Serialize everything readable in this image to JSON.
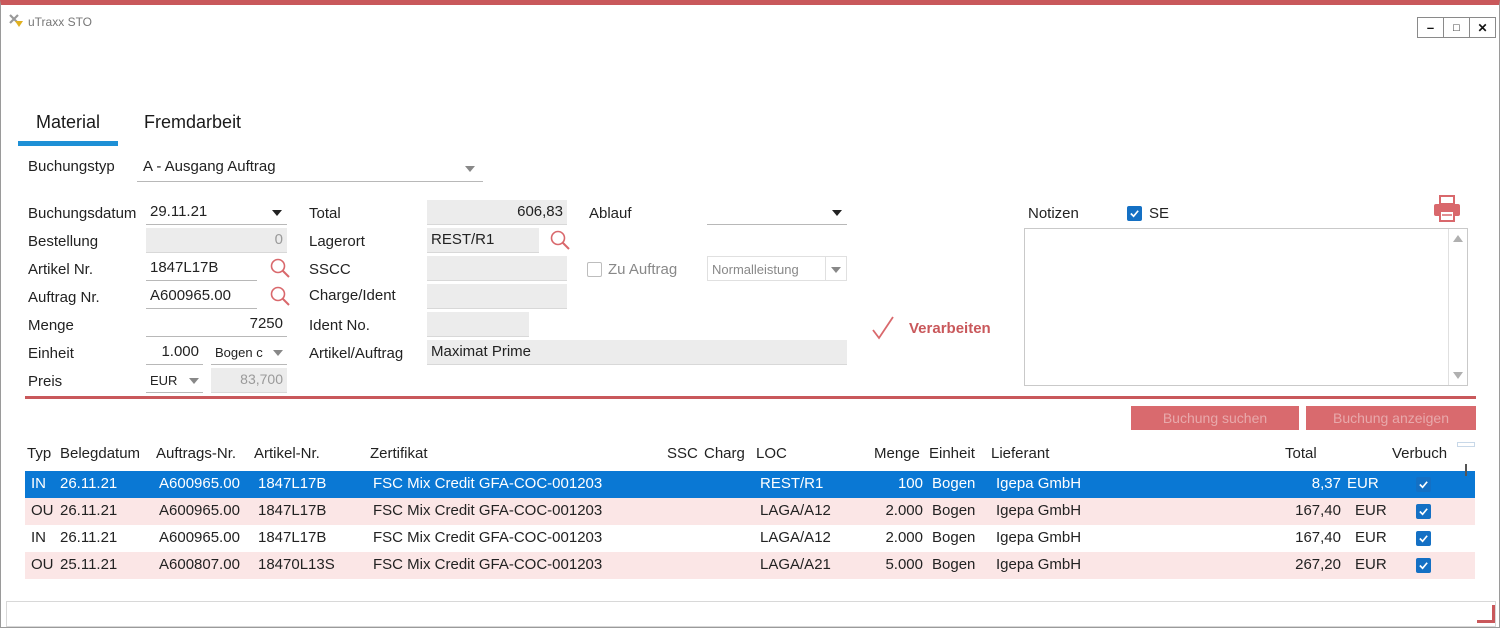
{
  "app": {
    "title": "uTraxx STO"
  },
  "window_controls": {
    "minimize": "–",
    "maximize": "□",
    "close": "✕"
  },
  "tabs": [
    {
      "label": "Material",
      "active": true
    },
    {
      "label": "Fremdarbeit",
      "active": false
    }
  ],
  "form": {
    "buchungstyp_label": "Buchungstyp",
    "buchungstyp_value": "A - Ausgang Auftrag",
    "buchungsdatum_label": "Buchungsdatum",
    "buchungsdatum_value": "29.11.21",
    "bestellung_label": "Bestellung",
    "bestellung_value": "0",
    "artikel_label": "Artikel Nr.",
    "artikel_value": "1847L17B",
    "auftrag_label": "Auftrag Nr.",
    "auftrag_value": "A600965.00",
    "menge_label": "Menge",
    "menge_value": "7250",
    "einheit_label": "Einheit",
    "einheit_qty": "1.000",
    "einheit_unit": "Bogen c",
    "preis_label": "Preis",
    "preis_currency": "EUR",
    "preis_value": "83,700",
    "total_label": "Total",
    "total_value": "606,83",
    "lagerort_label": "Lagerort",
    "lagerort_value": "REST/R1",
    "sscc_label": "SSCC",
    "sscc_value": "",
    "charge_label": "Charge/Ident",
    "charge_value": "",
    "identno_label": "Ident No.",
    "identno_value": "",
    "artikel_auftrag_label": "Artikel/Auftrag",
    "artikel_auftrag_value": "Maximat Prime",
    "ablauf_label": "Ablauf",
    "ablauf_value": "",
    "zu_auftrag_label": "Zu Auftrag",
    "zu_auftrag_checked": false,
    "leistung_value": "Normalleistung",
    "verarbeiten_label": "Verarbeiten"
  },
  "notes": {
    "label": "Notizen",
    "se_label": "SE",
    "se_checked": true,
    "text": ""
  },
  "actions": {
    "buchung_suchen": "Buchung suchen",
    "buchung_anzeigen": "Buchung anzeigen"
  },
  "table": {
    "headers": {
      "typ": "Typ",
      "belegdatum": "Belegdatum",
      "auftrags_nr": "Auftrags-Nr.",
      "artikel_nr": "Artikel-Nr.",
      "zertifikat": "Zertifikat",
      "ssc": "SSC",
      "charg": "Charg",
      "loc": "LOC",
      "menge": "Menge",
      "einheit": "Einheit",
      "lieferant": "Lieferant",
      "total": "Total",
      "verbuch": "Verbuch"
    },
    "rows": [
      {
        "typ": "IN",
        "belegdatum": "26.11.21",
        "auftrags_nr": "A600965.00",
        "artikel_nr": "1847L17B",
        "zertifikat": "FSC Mix Credit GFA-COC-001203",
        "loc": "REST/R1",
        "menge": "100",
        "einheit": "Bogen",
        "lieferant": "Igepa GmbH",
        "total": "8,37",
        "currency": "EUR",
        "verbuch": true
      },
      {
        "typ": "OU",
        "belegdatum": "26.11.21",
        "auftrags_nr": "A600965.00",
        "artikel_nr": "1847L17B",
        "zertifikat": "FSC Mix Credit GFA-COC-001203",
        "loc": "LAGA/A12",
        "menge": "2.000",
        "einheit": "Bogen",
        "lieferant": "Igepa GmbH",
        "total": "167,40",
        "currency": "EUR",
        "verbuch": true
      },
      {
        "typ": "IN",
        "belegdatum": "26.11.21",
        "auftrags_nr": "A600965.00",
        "artikel_nr": "1847L17B",
        "zertifikat": "FSC Mix Credit GFA-COC-001203",
        "loc": "LAGA/A12",
        "menge": "2.000",
        "einheit": "Bogen",
        "lieferant": "Igepa GmbH",
        "total": "167,40",
        "currency": "EUR",
        "verbuch": true
      },
      {
        "typ": "OU",
        "belegdatum": "25.11.21",
        "auftrags_nr": "A600807.00",
        "artikel_nr": "18470L13S",
        "zertifikat": "FSC Mix Credit GFA-COC-001203",
        "loc": "LAGA/A21",
        "menge": "5.000",
        "einheit": "Bogen",
        "lieferant": "Igepa GmbH",
        "total": "267,20",
        "currency": "EUR",
        "verbuch": true
      }
    ]
  },
  "colors": {
    "accent_red": "#c9585b",
    "selection_blue": "#0a78d4",
    "tab_underline": "#1e90d6",
    "alt_row": "#fbe6e6"
  }
}
